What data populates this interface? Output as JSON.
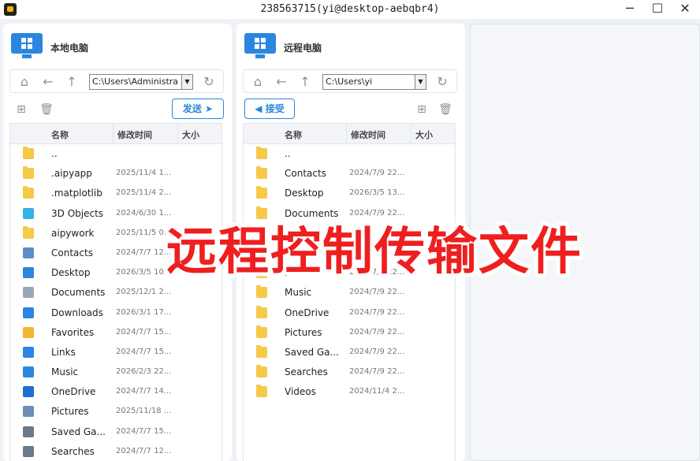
{
  "window": {
    "title": "238563715(yi@desktop-aebqbr4)",
    "minimize": "─",
    "maximize": "☐",
    "close": "✕"
  },
  "local": {
    "title": "本地电脑",
    "path": "C:\\Users\\Administra",
    "action": "发送 ➤",
    "columns": [
      "名称",
      "修改时间",
      "大小"
    ],
    "files": [
      {
        "name": "..",
        "time": "",
        "icon": "folder-icon",
        "color": "#f7c948"
      },
      {
        "name": ".aipyapp",
        "time": "2025/11/4 1...",
        "icon": "folder-icon",
        "color": "#f7c948"
      },
      {
        "name": ".matplotlib",
        "time": "2025/11/4 2...",
        "icon": "folder-icon",
        "color": "#f7c948"
      },
      {
        "name": "3D Objects",
        "time": "2024/6/30 1...",
        "icon": "3d-objects-icon",
        "color": "#34b1e6"
      },
      {
        "name": "aipywork",
        "time": "2025/11/5 0...",
        "icon": "folder-icon",
        "color": "#f7c948"
      },
      {
        "name": "Contacts",
        "time": "2024/7/7 12...",
        "icon": "contacts-icon",
        "color": "#5d8fc7"
      },
      {
        "name": "Desktop",
        "time": "2026/3/5 10...",
        "icon": "desktop-icon",
        "color": "#2b86e0"
      },
      {
        "name": "Documents",
        "time": "2025/12/1 2...",
        "icon": "documents-icon",
        "color": "#9aa7b7"
      },
      {
        "name": "Downloads",
        "time": "2026/3/1 17...",
        "icon": "downloads-icon",
        "color": "#2b86e0"
      },
      {
        "name": "Favorites",
        "time": "2024/7/7 15...",
        "icon": "star-icon",
        "color": "#f2b632"
      },
      {
        "name": "Links",
        "time": "2024/7/7 15...",
        "icon": "links-icon",
        "color": "#2b86e0"
      },
      {
        "name": "Music",
        "time": "2026/2/3 22...",
        "icon": "music-icon",
        "color": "#2b86e0"
      },
      {
        "name": "OneDrive",
        "time": "2024/7/7 14...",
        "icon": "onedrive-icon",
        "color": "#1c6fd0"
      },
      {
        "name": "Pictures",
        "time": "2025/11/18 ...",
        "icon": "pictures-icon",
        "color": "#6c8fb3"
      },
      {
        "name": "Saved Ga...",
        "time": "2024/7/7 15...",
        "icon": "saved-games-icon",
        "color": "#6b7a8a"
      },
      {
        "name": "Searches",
        "time": "2024/7/7 12...",
        "icon": "searches-icon",
        "color": "#6b7a8a"
      }
    ]
  },
  "remote": {
    "title": "远程电脑",
    "path": "C:\\Users\\yi",
    "action": "◀ 接受",
    "columns": [
      "名称",
      "修改时间",
      "大小"
    ],
    "files": [
      {
        "name": "..",
        "time": "",
        "icon": "folder-icon",
        "color": "#f7c948"
      },
      {
        "name": "Contacts",
        "time": "2024/7/9 22...",
        "icon": "folder-icon",
        "color": "#f7c948"
      },
      {
        "name": "Desktop",
        "time": "2026/3/5 13...",
        "icon": "folder-icon",
        "color": "#f7c948"
      },
      {
        "name": "Documents",
        "time": "2024/7/9 22...",
        "icon": "folder-icon",
        "color": "#f7c948"
      },
      {
        "name": "",
        "time": "",
        "icon": "folder-icon",
        "color": "#f7c948"
      },
      {
        "name": "",
        "time": "",
        "icon": "folder-icon",
        "color": "#f7c948"
      },
      {
        "name": "Links",
        "time": "2024/7/9 22...",
        "icon": "folder-icon",
        "color": "#f7c948"
      },
      {
        "name": "Music",
        "time": "2024/7/9 22...",
        "icon": "folder-icon",
        "color": "#f7c948"
      },
      {
        "name": "OneDrive",
        "time": "2024/7/9 22...",
        "icon": "folder-icon",
        "color": "#f7c948"
      },
      {
        "name": "Pictures",
        "time": "2024/7/9 22...",
        "icon": "folder-icon",
        "color": "#f7c948"
      },
      {
        "name": "Saved Ga...",
        "time": "2024/7/9 22...",
        "icon": "folder-icon",
        "color": "#f7c948"
      },
      {
        "name": "Searches",
        "time": "2024/7/9 22...",
        "icon": "folder-icon",
        "color": "#f7c948"
      },
      {
        "name": "Videos",
        "time": "2024/11/4 2...",
        "icon": "folder-icon",
        "color": "#f7c948"
      }
    ]
  },
  "overlay_caption": "远程控制传输文件",
  "colors": {
    "accent": "#2b86e0",
    "caption": "#ef1f1f"
  }
}
